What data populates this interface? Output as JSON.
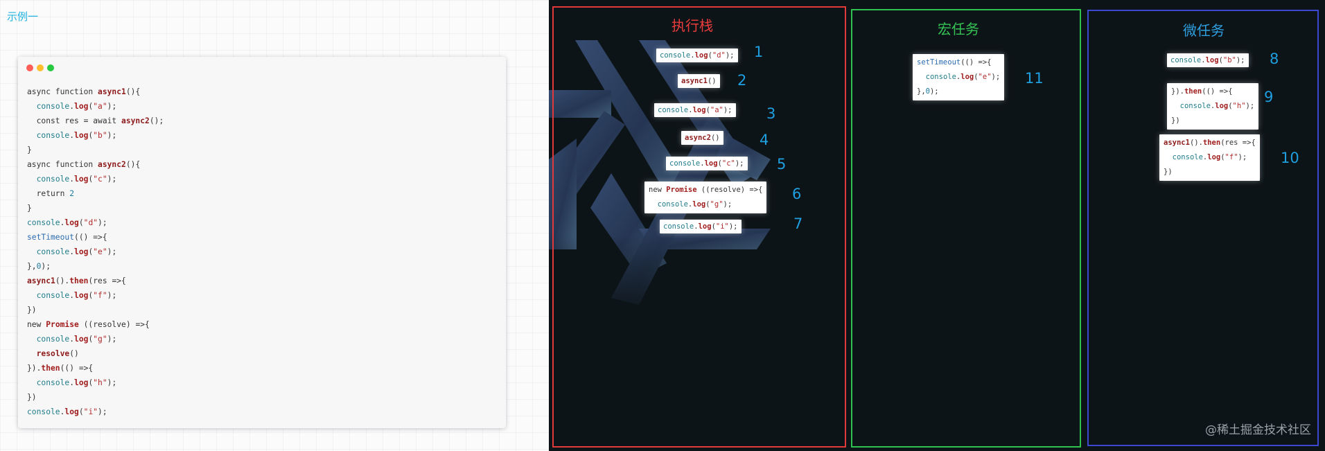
{
  "heading": "示例一",
  "code_window": {
    "dot_colors": [
      "#ff5f57",
      "#ffbd2e",
      "#28c840"
    ],
    "lines": [
      [
        [
          "kw",
          "async function "
        ],
        [
          "fn",
          "async1"
        ],
        [
          "p",
          "(){"
        ]
      ],
      [
        [
          "p",
          "  "
        ],
        [
          "obj",
          "console"
        ],
        [
          "p",
          "."
        ],
        [
          "meth",
          "log"
        ],
        [
          "p",
          "("
        ],
        [
          "str",
          "\"a\""
        ],
        [
          "p",
          ");"
        ]
      ],
      [
        [
          "p",
          "  const res = await "
        ],
        [
          "fn",
          "async2"
        ],
        [
          "p",
          "();"
        ]
      ],
      [
        [
          "p",
          "  "
        ],
        [
          "obj",
          "console"
        ],
        [
          "p",
          "."
        ],
        [
          "meth",
          "log"
        ],
        [
          "p",
          "("
        ],
        [
          "str",
          "\"b\""
        ],
        [
          "p",
          ");"
        ]
      ],
      [
        [
          "p",
          "}"
        ]
      ],
      [
        [
          "kw",
          "async function "
        ],
        [
          "fn",
          "async2"
        ],
        [
          "p",
          "(){"
        ]
      ],
      [
        [
          "p",
          "  "
        ],
        [
          "obj",
          "console"
        ],
        [
          "p",
          "."
        ],
        [
          "meth",
          "log"
        ],
        [
          "p",
          "("
        ],
        [
          "str",
          "\"c\""
        ],
        [
          "p",
          ");"
        ]
      ],
      [
        [
          "p",
          "  return "
        ],
        [
          "num",
          "2"
        ]
      ],
      [
        [
          "p",
          "}"
        ]
      ],
      [
        [
          "obj",
          "console"
        ],
        [
          "p",
          "."
        ],
        [
          "meth",
          "log"
        ],
        [
          "p",
          "("
        ],
        [
          "str",
          "\"d\""
        ],
        [
          "p",
          ");"
        ]
      ],
      [
        [
          "builtin",
          "setTimeout"
        ],
        [
          "p",
          "(() =>{"
        ]
      ],
      [
        [
          "p",
          "  "
        ],
        [
          "obj",
          "console"
        ],
        [
          "p",
          "."
        ],
        [
          "meth",
          "log"
        ],
        [
          "p",
          "("
        ],
        [
          "str",
          "\"e\""
        ],
        [
          "p",
          ");"
        ]
      ],
      [
        [
          "p",
          "},"
        ],
        [
          "num",
          "0"
        ],
        [
          "p",
          ");"
        ]
      ],
      [
        [
          "fn",
          "async1"
        ],
        [
          "p",
          "()."
        ],
        [
          "meth",
          "then"
        ],
        [
          "p",
          "(res =>{"
        ]
      ],
      [
        [
          "p",
          "  "
        ],
        [
          "obj",
          "console"
        ],
        [
          "p",
          "."
        ],
        [
          "meth",
          "log"
        ],
        [
          "p",
          "("
        ],
        [
          "str",
          "\"f\""
        ],
        [
          "p",
          ");"
        ]
      ],
      [
        [
          "p",
          "})"
        ]
      ],
      [
        [
          "kw",
          "new "
        ],
        [
          "cls",
          "Promise"
        ],
        [
          "p",
          " ((resolve) =>{"
        ]
      ],
      [
        [
          "p",
          "  "
        ],
        [
          "obj",
          "console"
        ],
        [
          "p",
          "."
        ],
        [
          "meth",
          "log"
        ],
        [
          "p",
          "("
        ],
        [
          "str",
          "\"g\""
        ],
        [
          "p",
          ");"
        ]
      ],
      [
        [
          "p",
          "  "
        ],
        [
          "fn",
          "resolve"
        ],
        [
          "p",
          "()"
        ]
      ],
      [
        [
          "p",
          "})."
        ],
        [
          "meth",
          "then"
        ],
        [
          "p",
          "(() =>{"
        ]
      ],
      [
        [
          "p",
          "  "
        ],
        [
          "obj",
          "console"
        ],
        [
          "p",
          "."
        ],
        [
          "meth",
          "log"
        ],
        [
          "p",
          "("
        ],
        [
          "str",
          "\"h\""
        ],
        [
          "p",
          ");"
        ]
      ],
      [
        [
          "p",
          "})"
        ]
      ],
      [
        [
          "obj",
          "console"
        ],
        [
          "p",
          "."
        ],
        [
          "meth",
          "log"
        ],
        [
          "p",
          "("
        ],
        [
          "str",
          "\"i\""
        ],
        [
          "p",
          ");"
        ]
      ]
    ]
  },
  "diagram": {
    "titles": {
      "execution_stack": "执行栈",
      "macrotask": "宏任务",
      "microtask": "微任务"
    },
    "panel_colors": {
      "execution_stack": "#e23a3a",
      "macrotask": "#2ec24f",
      "microtask": "#3c48cf"
    },
    "execution_stack": [
      {
        "num": "1",
        "code": [
          [
            [
              "obj",
              "console"
            ],
            [
              "p",
              "."
            ],
            [
              "meth",
              "log"
            ],
            [
              "p",
              "("
            ],
            [
              "str",
              "\"d\""
            ],
            [
              "p",
              ");"
            ]
          ]
        ]
      },
      {
        "num": "2",
        "code": [
          [
            [
              "fn",
              "async1"
            ],
            [
              "p",
              "()"
            ]
          ]
        ]
      },
      {
        "num": "3",
        "code": [
          [
            [
              "obj",
              "console"
            ],
            [
              "p",
              "."
            ],
            [
              "meth",
              "log"
            ],
            [
              "p",
              "("
            ],
            [
              "str",
              "\"a\""
            ],
            [
              "p",
              ");"
            ]
          ]
        ]
      },
      {
        "num": "4",
        "code": [
          [
            [
              "fn",
              "async2"
            ],
            [
              "p",
              "()"
            ]
          ]
        ]
      },
      {
        "num": "5",
        "code": [
          [
            [
              "obj",
              "console"
            ],
            [
              "p",
              "."
            ],
            [
              "meth",
              "log"
            ],
            [
              "p",
              "("
            ],
            [
              "str",
              "\"c\""
            ],
            [
              "p",
              ");"
            ]
          ]
        ]
      },
      {
        "num": "6",
        "code": [
          [
            [
              "kw",
              "new "
            ],
            [
              "cls",
              "Promise"
            ],
            [
              "p",
              " ((resolve) =>{"
            ]
          ],
          [
            [
              "p",
              "  "
            ],
            [
              "obj",
              "console"
            ],
            [
              "p",
              "."
            ],
            [
              "meth",
              "log"
            ],
            [
              "p",
              "("
            ],
            [
              "str",
              "\"g\""
            ],
            [
              "p",
              ");"
            ]
          ]
        ]
      },
      {
        "num": "7",
        "code": [
          [
            [
              "obj",
              "console"
            ],
            [
              "p",
              "."
            ],
            [
              "meth",
              "log"
            ],
            [
              "p",
              "("
            ],
            [
              "str",
              "\"i\""
            ],
            [
              "p",
              ");"
            ]
          ]
        ]
      }
    ],
    "macrotask": [
      {
        "num": "11",
        "code": [
          [
            [
              "builtin",
              "setTimeout"
            ],
            [
              "p",
              "(() =>{"
            ]
          ],
          [
            [
              "p",
              "  "
            ],
            [
              "obj",
              "console"
            ],
            [
              "p",
              "."
            ],
            [
              "meth",
              "log"
            ],
            [
              "p",
              "("
            ],
            [
              "str",
              "\"e\""
            ],
            [
              "p",
              ");"
            ]
          ],
          [
            [
              "p",
              "},"
            ],
            [
              "num",
              "0"
            ],
            [
              "p",
              ");"
            ]
          ]
        ]
      }
    ],
    "microtask": [
      {
        "num": "8",
        "code": [
          [
            [
              "obj",
              "console"
            ],
            [
              "p",
              "."
            ],
            [
              "meth",
              "log"
            ],
            [
              "p",
              "("
            ],
            [
              "str",
              "\"b\""
            ],
            [
              "p",
              ");"
            ]
          ]
        ]
      },
      {
        "num": "9",
        "code": [
          [
            [
              "p",
              "})."
            ],
            [
              "meth",
              "then"
            ],
            [
              "p",
              "(() =>{"
            ]
          ],
          [
            [
              "p",
              "  "
            ],
            [
              "obj",
              "console"
            ],
            [
              "p",
              "."
            ],
            [
              "meth",
              "log"
            ],
            [
              "p",
              "("
            ],
            [
              "str",
              "\"h\""
            ],
            [
              "p",
              ");"
            ]
          ],
          [
            [
              "p",
              "})"
            ]
          ]
        ]
      },
      {
        "num": "10",
        "code": [
          [
            [
              "fn",
              "async1"
            ],
            [
              "p",
              "()."
            ],
            [
              "meth",
              "then"
            ],
            [
              "p",
              "(res =>{"
            ]
          ],
          [
            [
              "p",
              "  "
            ],
            [
              "obj",
              "console"
            ],
            [
              "p",
              "."
            ],
            [
              "meth",
              "log"
            ],
            [
              "p",
              "("
            ],
            [
              "str",
              "\"f\""
            ],
            [
              "p",
              ");"
            ]
          ],
          [
            [
              "p",
              "})"
            ]
          ]
        ]
      }
    ],
    "watermark": "@稀土掘金技术社区"
  }
}
